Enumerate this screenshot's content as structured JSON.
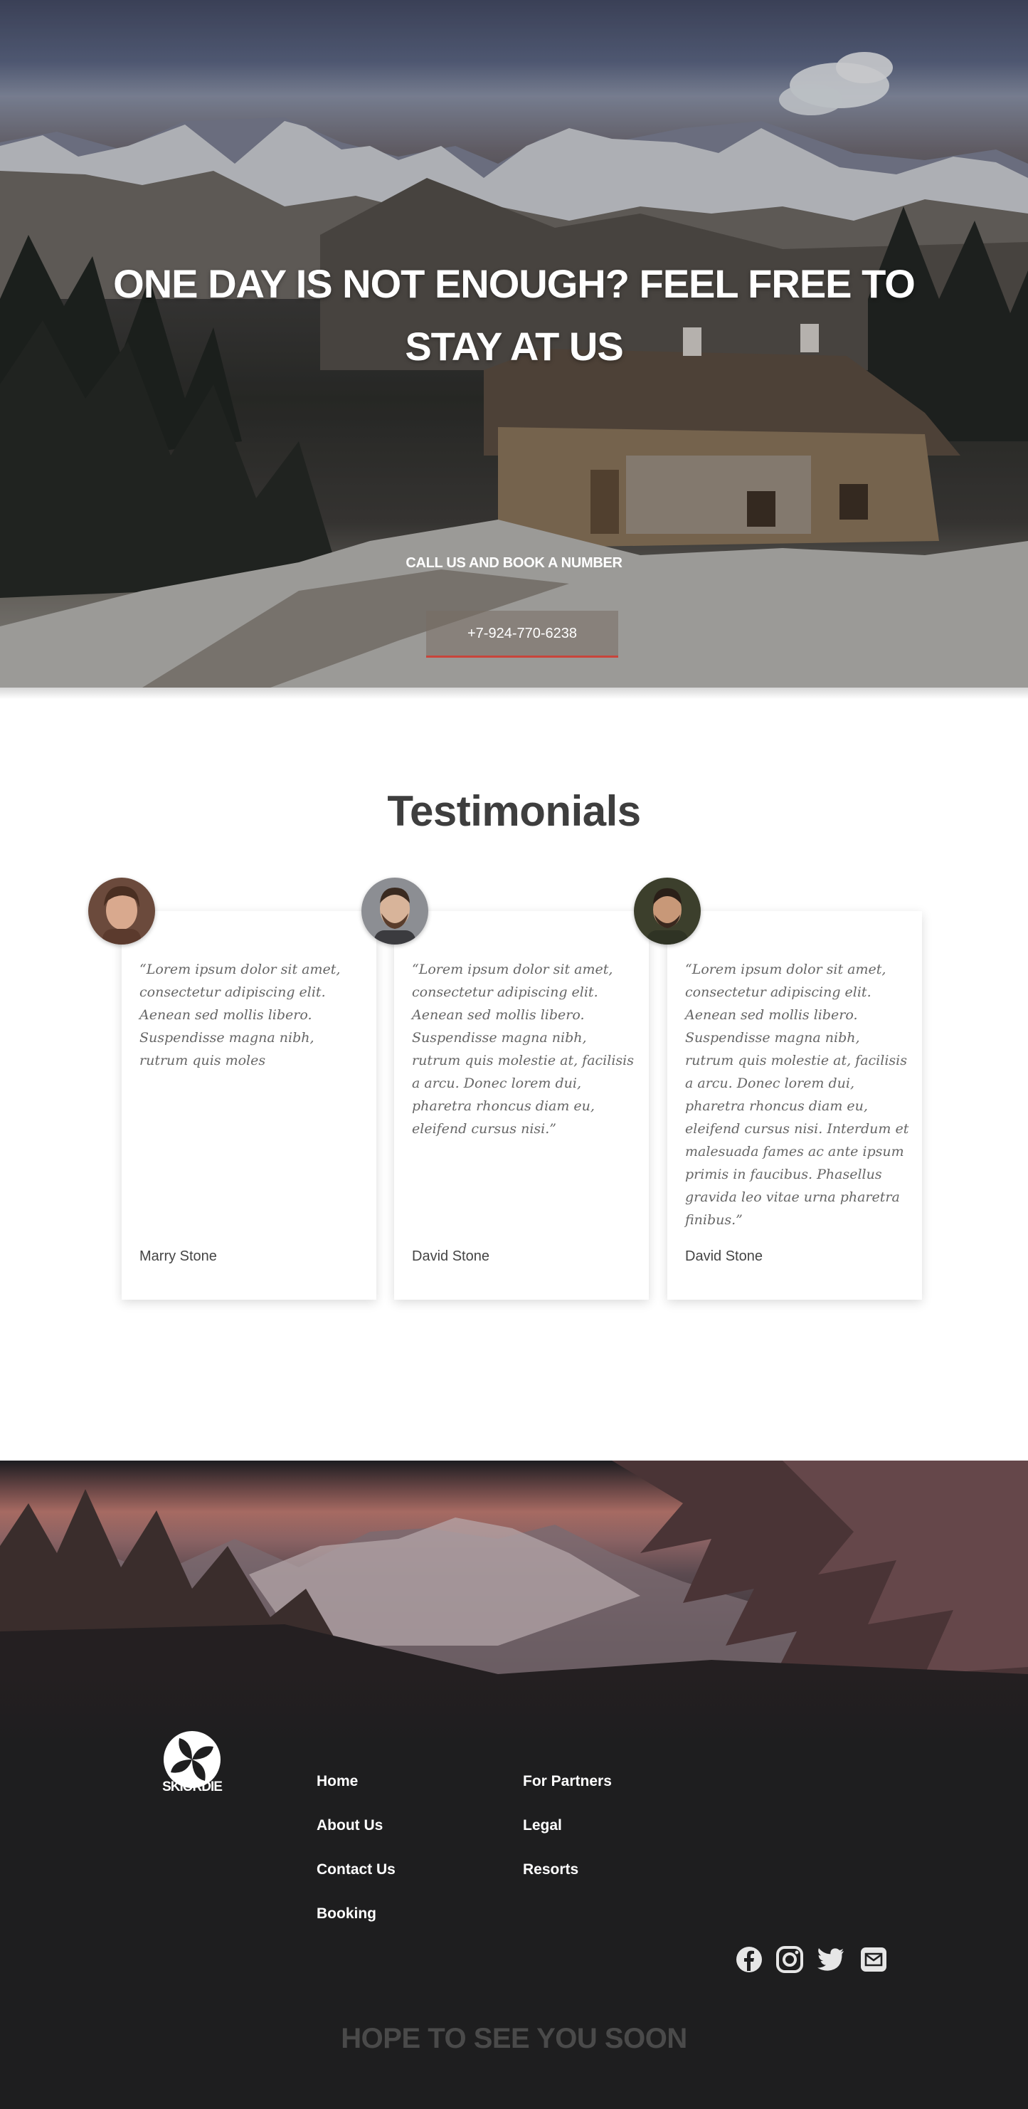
{
  "hero": {
    "title_line1": "ONE DAY IS NOT ENOUGH? FEEL FREE TO",
    "title_line2": "STAY AT US",
    "subtitle": "CALL US AND BOOK A NUMBER",
    "phone_button": "+7-924-770-6238"
  },
  "testimonials": {
    "title": "Testimonials",
    "items": [
      {
        "quote": "“Lorem ipsum dolor sit amet, consectetur adipiscing elit. Aenean sed mollis libero. Suspendisse magna nibh, rutrum quis moles",
        "name": "Marry Stone"
      },
      {
        "quote": "“Lorem ipsum dolor sit amet, consectetur adipiscing elit. Aenean sed mollis libero. Suspendisse magna nibh, rutrum quis molestie at, facilisis a arcu. Donec lorem dui, pharetra rhoncus diam eu, eleifend cursus nisi.”",
        "name": "David Stone"
      },
      {
        "quote": "“Lorem ipsum dolor sit amet, consectetur adipiscing elit. Aenean sed mollis libero. Suspendisse magna nibh, rutrum quis molestie at, facilisis a arcu. Donec lorem dui, pharetra rhoncus diam eu, eleifend cursus nisi. Interdum et malesuada fames ac ante ipsum primis in faucibus. Phasellus gravida leo vitae urna pharetra finibus.”",
        "name": "David Stone"
      }
    ]
  },
  "footer": {
    "logo_text": "SKIORDIE",
    "nav_col1": [
      "Home",
      "About Us",
      "Contact Us",
      "Booking"
    ],
    "nav_col2": [
      "For Partners",
      "Legal",
      "Resorts"
    ],
    "social_icons": [
      "facebook-icon",
      "instagram-icon",
      "twitter-icon",
      "email-icon"
    ],
    "tagline": "HOPE TO SEE YOU SOON"
  },
  "colors": {
    "accent": "#c9453b",
    "footer_bg": "#1e1e1f",
    "heading": "#3e3e3e"
  }
}
